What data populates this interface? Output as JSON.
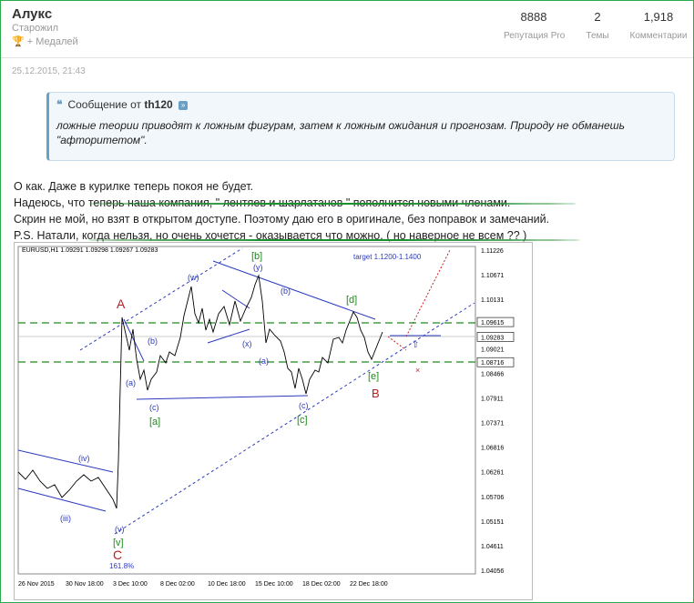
{
  "user": {
    "name": "Алукс",
    "rank": "Старожил",
    "medals": "+ Медалей",
    "medal_icon": "trophy-icon"
  },
  "stats": [
    {
      "value": "8888",
      "label": "Репутация Pro"
    },
    {
      "value": "2",
      "label": "Темы"
    },
    {
      "value": "1,918",
      "label": "Комментарии"
    }
  ],
  "post_date": "25.12.2015, 21:43",
  "quote": {
    "header_prefix": "Сообщение от",
    "author": "th120",
    "icon": "quote-icon",
    "jump_icon": "jump-to-post-icon",
    "text": "ложные теории приводят к ложным фигурам, затем к ложным ожидания и прогнозам. Природу не обманешь \"афторитетом\"."
  },
  "body_lines": [
    "О как. Даже в курилке теперь покоя не будет.",
    "Надеюсь, что теперь наша компания, \" лентяев и шарлатанов \" пополнится новыми членами.",
    "Скрин не мой, но взят в открытом доступе. Поэтому даю его в оригинале, без поправок и замечаний.",
    "P.S. Натали, когда нельзя, но очень хочется - оказывается что можно. ( но наверное не всем ?? )"
  ],
  "chart": {
    "symbol_header": "EURUSD,H1  1.09291 1.09298 1.09267 1.09283",
    "target_note": "target 1.1200-1.1400",
    "price_axis": [
      "1.11226",
      "1.10671",
      "1.10131",
      "1.09615",
      "1.09283",
      "1.09021",
      "1.08716",
      "1.08466",
      "1.07911",
      "1.07371",
      "1.06816",
      "1.06261",
      "1.05706",
      "1.05151",
      "1.04611",
      "1.04056"
    ],
    "highlight_prices": [
      "1.09615",
      "1.09283",
      "1.08716"
    ],
    "time_axis": [
      "26 Nov 2015",
      "30 Nov 18:00",
      "3 Dec 10:00",
      "8 Dec 02:00",
      "10 Dec 18:00",
      "15 Dec 10:00",
      "18 Dec 02:00",
      "22 Dec 18:00"
    ],
    "wave_labels": {
      "A": "A",
      "B": "B",
      "C": "C",
      "a_top": "(a)",
      "b_top": "(b)",
      "c_top": "(c)",
      "a_bottom": "[a]",
      "b_bottom": "[b]",
      "c_bottom": "[c]",
      "d_bottom": "[d]",
      "e_bottom": "[e]",
      "v_bottom": "[v]",
      "w": "(w)",
      "x": "(x)",
      "y": "(y)",
      "iv": "(iv)",
      "iii": "(iii)",
      "v": "(v)",
      "a_mid": "(a)",
      "b_mid": "(b)",
      "c_mid": "(c)",
      "a_small": "(a)",
      "fib": "161.8%"
    },
    "colors": {
      "candles": "#000000",
      "dash_green": "#1e8a1e",
      "trend_blue": "#2b3bbd",
      "red": "#cc2222",
      "axis_highlight": "#ffffff"
    }
  }
}
